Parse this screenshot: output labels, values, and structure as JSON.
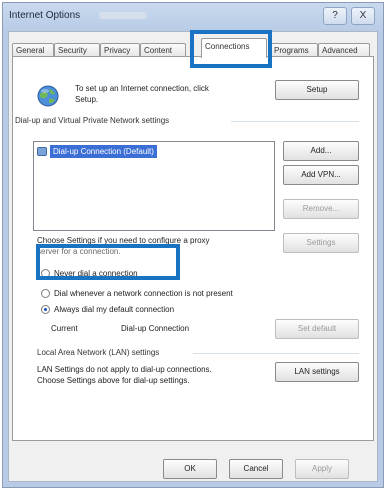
{
  "window": {
    "title": "Internet Options"
  },
  "title_buttons": {
    "help": "?",
    "close": "X"
  },
  "tabs": [
    {
      "label": "General"
    },
    {
      "label": "Security"
    },
    {
      "label": "Privacy"
    },
    {
      "label": "Content"
    },
    {
      "label": "Connections"
    },
    {
      "label": "Programs"
    },
    {
      "label": "Advanced"
    }
  ],
  "setup": {
    "text_line1": "To set up an Internet connection, click",
    "text_line2": "Setup.",
    "button": "Setup"
  },
  "dialup": {
    "group_label": "Dial-up and Virtual Private Network settings",
    "items": [
      {
        "label": "Dial-up Connection (Default)"
      }
    ],
    "add_button": "Add...",
    "add_vpn_button": "Add VPN...",
    "remove_button": "Remove...",
    "settings_button": "Settings",
    "proxy_line1": "Choose Settings if you need to configure a proxy",
    "proxy_line2": "server for a connection.",
    "options": [
      {
        "label": "Never dial a connection",
        "selected": false
      },
      {
        "label": "Dial whenever a network connection is not present",
        "selected": false
      },
      {
        "label": "Always dial my default connection",
        "selected": true
      }
    ],
    "current_label": "Current",
    "current_value": "Dial-up Connection",
    "set_default_button": "Set default"
  },
  "lan": {
    "group_label": "Local Area Network (LAN) settings",
    "text_line1": "LAN Settings do not apply to dial-up connections.",
    "text_line2": "Choose Settings above for dial-up settings.",
    "button": "LAN settings"
  },
  "footer": {
    "ok": "OK",
    "cancel": "Cancel",
    "apply": "Apply"
  },
  "highlight_color": "#1a72c4"
}
